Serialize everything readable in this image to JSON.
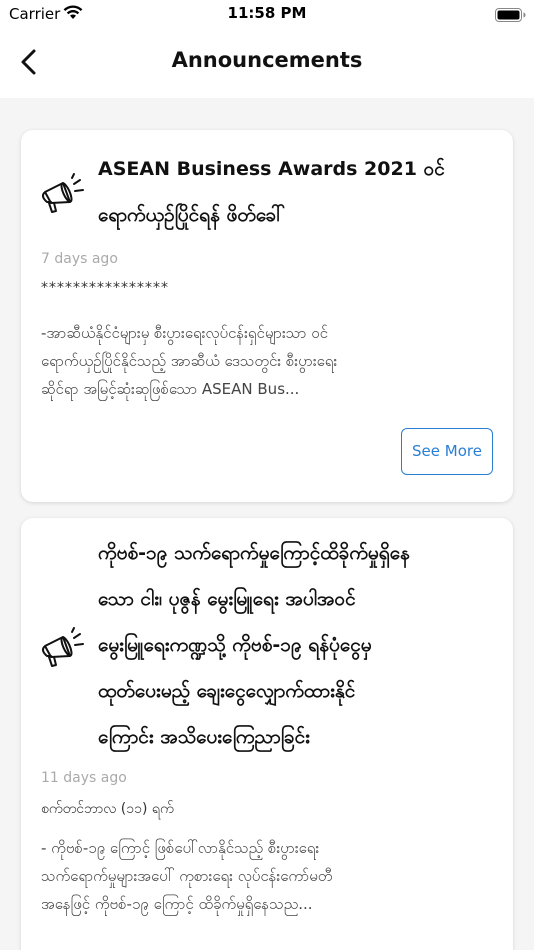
{
  "status_bar": {
    "carrier": "Carrier",
    "time": "11:58 PM",
    "icons": [
      "wifi-icon",
      "battery-icon"
    ]
  },
  "nav": {
    "back_icon": "chevron-left-icon",
    "title": "Announcements"
  },
  "announcements": [
    {
      "icon": "megaphone-icon",
      "title": "ASEAN Business Awards 2021 ဝင်\nရောက်ယှဉ်ပြိုင်ရန် ဖိတ်ခေါ်",
      "date": "7 days ago",
      "subtitle": "****************",
      "body": "-အာဆီယံနိုင်ငံများမှ စီးပွားရေးလုပ်ငန်းရှင်များသာ ဝင်\nရောက်ယှဉ်ပြိုင်နိုင်သည့် အာဆီယံ ဒေသတွင်း စီးပွားရေး\nဆိုင်ရာ အမြင့်ဆုံးဆုဖြစ်သော ASEAN Bus...",
      "button_label": "See More"
    },
    {
      "icon": "megaphone-icon",
      "title": "ကိုဗစ်-၁၉ သက်ရောက်မှုကြောင့်ထိခိုက်မှုရှိနေ\nသော ငါး၊ ပုဇွန် မွေးမြူရေး အပါအဝင်\nမွေးမြူရေးကဏ္ဍသို့ ကိုဗစ်-၁၉ ရန်ပုံငွေမှ\nထုတ်ပေးမည့် ချေးငွေလျှောက်ထားနိုင်\nကြောင်း အသိပေးကြေညာခြင်း",
      "date": "11 days ago",
      "subtitle": "စက်တင်ဘာလ (၁၁) ရက်",
      "body": "- ကိုဗစ်-၁၉ ကြောင့် ဖြစ်ပေါ်လာနိုင်သည့် စီးပွားရေး\nသက်ရောက်မှုများအပေါ် ကုစားရေး လုပ်ငန်းကော်မတီ\nအနေဖြင့် ကိုဗစ်-၁၉ ကြောင့် ထိခိုက်မှုရှိနေသည..."
    }
  ],
  "colors": {
    "accent": "#2a7fd4",
    "background": "#f5f5f5",
    "card": "#ffffff",
    "muted_text": "#aaaaaa"
  }
}
